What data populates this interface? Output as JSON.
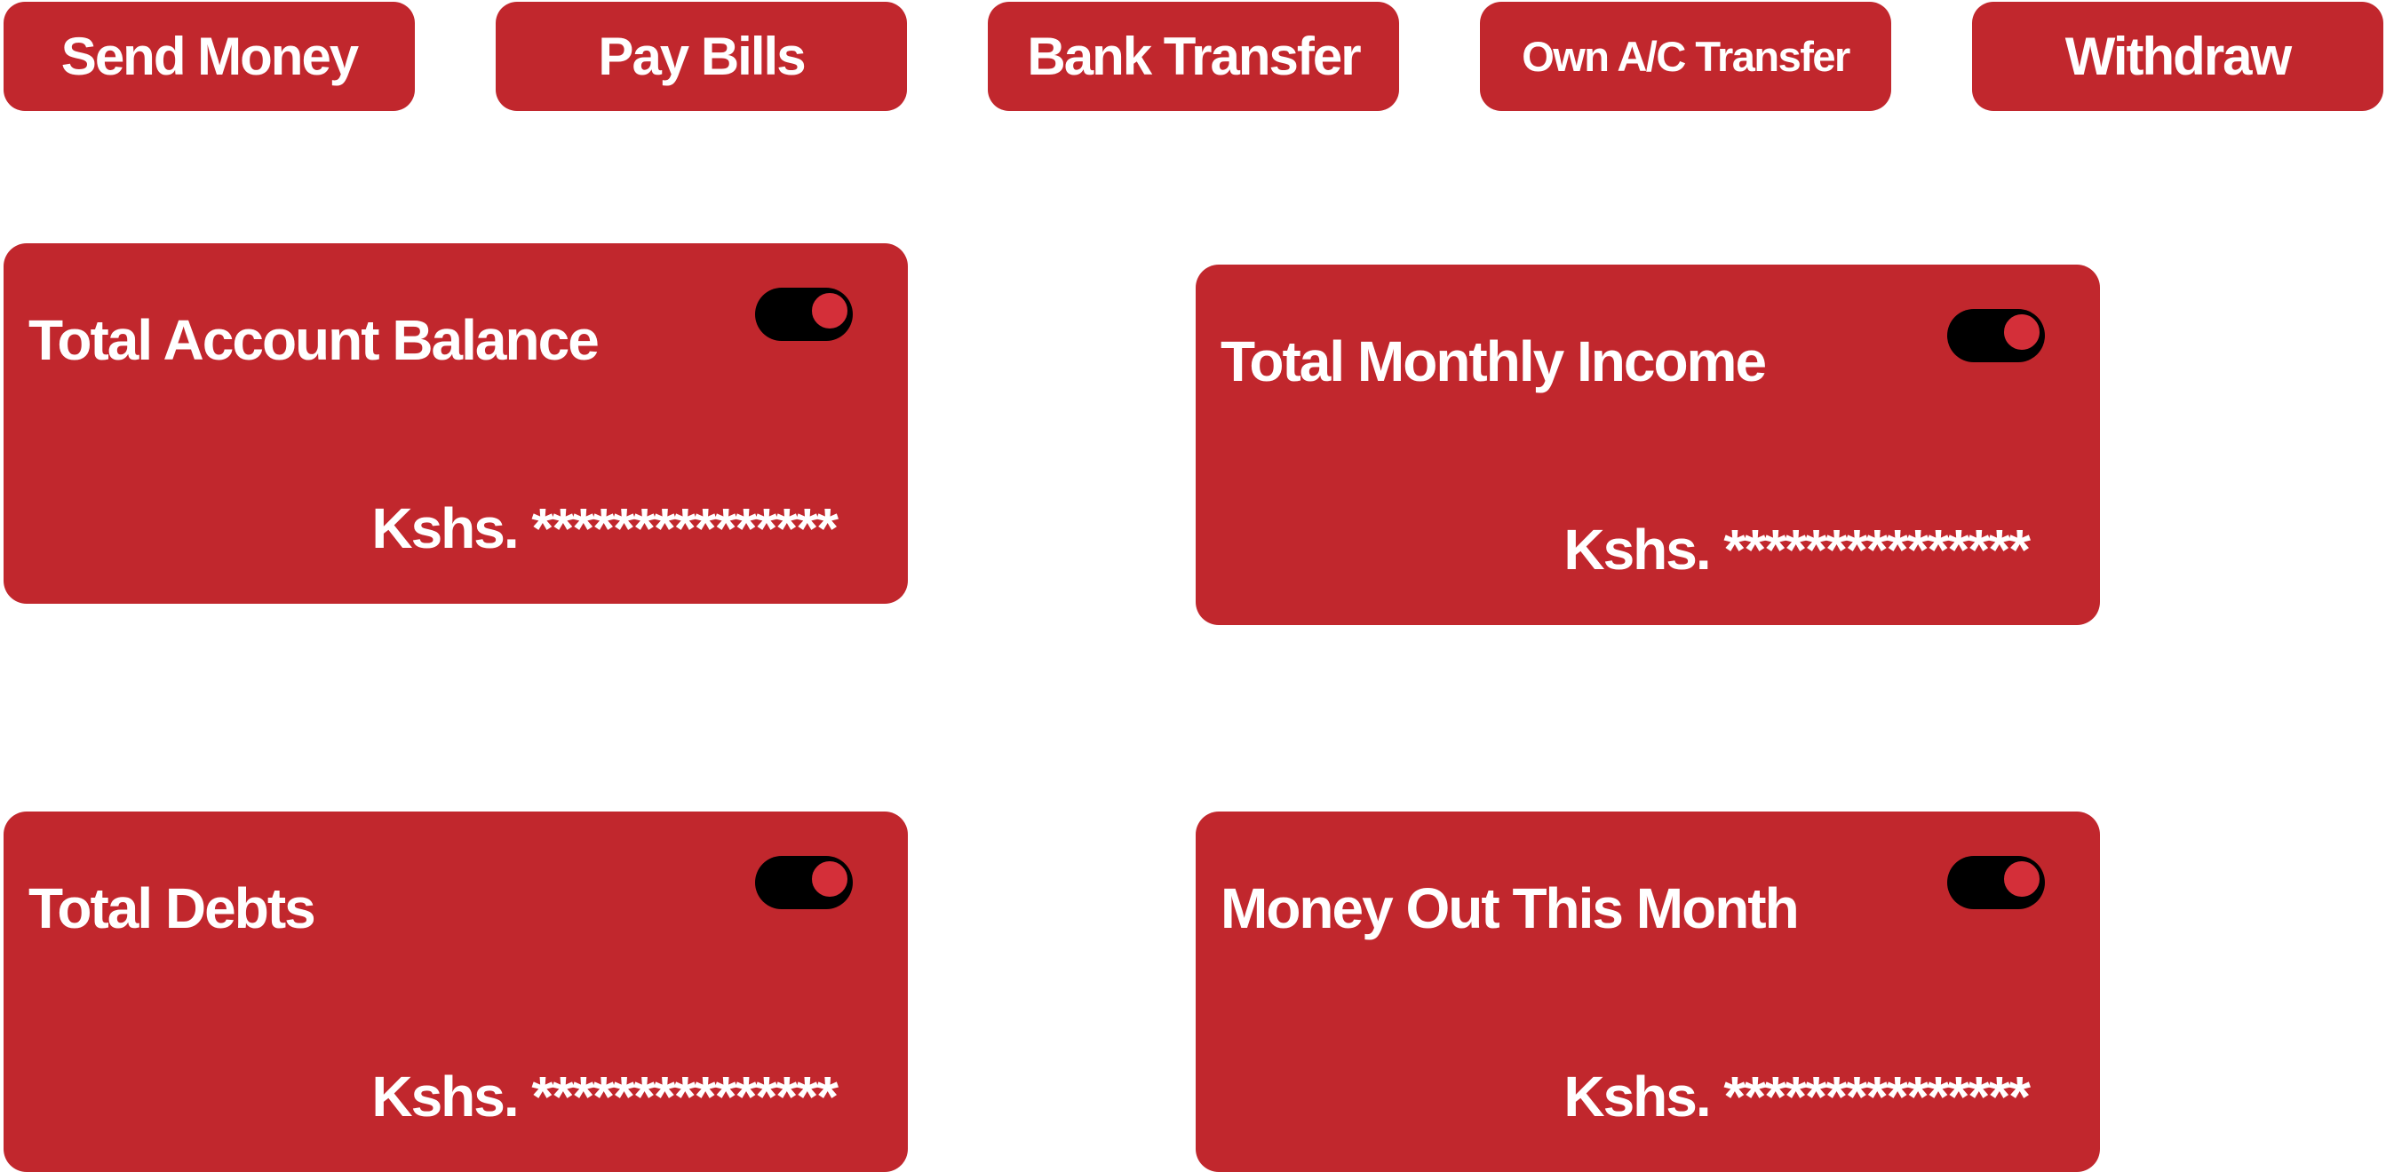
{
  "actions": [
    {
      "label": "Send Money"
    },
    {
      "label": "Pay Bills"
    },
    {
      "label": "Bank Transfer"
    },
    {
      "label": "Own A/C Transfer"
    },
    {
      "label": "Withdraw"
    }
  ],
  "cards": [
    {
      "title": "Total Account Balance",
      "amount": "Kshs. ***************",
      "toggle_on": true
    },
    {
      "title": "Total Monthly Income",
      "amount": "Kshs. ***************",
      "toggle_on": true
    },
    {
      "title": "Total Debts",
      "amount": "Kshs. ***************",
      "toggle_on": true
    },
    {
      "title": "Money Out This Month",
      "amount": "Kshs. ***************",
      "toggle_on": true
    }
  ],
  "colors": {
    "brand_red": "#c1272d",
    "toggle_track": "#000000",
    "toggle_knob": "#d42f39",
    "text": "#ffffff"
  }
}
